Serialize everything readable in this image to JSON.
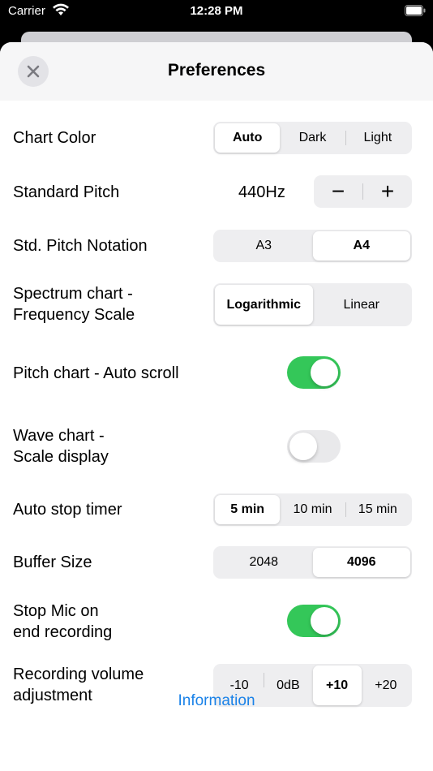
{
  "status_bar": {
    "carrier": "Carrier",
    "time": "12:28 PM"
  },
  "header": {
    "title": "Preferences",
    "close_icon": "close-icon"
  },
  "chart_color": {
    "label": "Chart Color",
    "options": [
      "Auto",
      "Dark",
      "Light"
    ],
    "selected": "Auto"
  },
  "standard_pitch": {
    "label": "Standard Pitch",
    "value": "440Hz",
    "minus": "−",
    "plus": "+"
  },
  "pitch_notation": {
    "label": "Std. Pitch Notation",
    "options": [
      "A3",
      "A4"
    ],
    "selected": "A4"
  },
  "spectrum_scale": {
    "label_line1": "Spectrum chart -",
    "label_line2": "Frequency Scale",
    "options": [
      "Logarithmic",
      "Linear"
    ],
    "selected": "Logarithmic"
  },
  "pitch_auto_scroll": {
    "label": "Pitch chart - Auto scroll",
    "on": true
  },
  "wave_scale_display": {
    "label_line1": "Wave chart -",
    "label_line2": "Scale display",
    "on": false
  },
  "auto_stop_timer": {
    "label": "Auto stop timer",
    "options": [
      "5 min",
      "10 min",
      "15 min"
    ],
    "selected": "5 min"
  },
  "buffer_size": {
    "label": "Buffer Size",
    "options": [
      "2048",
      "4096"
    ],
    "selected": "4096"
  },
  "stop_mic": {
    "label_line1": "Stop Mic on",
    "label_line2": "end recording",
    "on": true
  },
  "recording_volume": {
    "label_line1": "Recording volume",
    "label_line2": "adjustment",
    "options": [
      "-10",
      "0dB",
      "+10",
      "+20"
    ],
    "selected": "+10"
  },
  "footer": {
    "information_link": "Information"
  },
  "colors": {
    "toggle_on": "#34c759",
    "link": "#1a82e8"
  }
}
